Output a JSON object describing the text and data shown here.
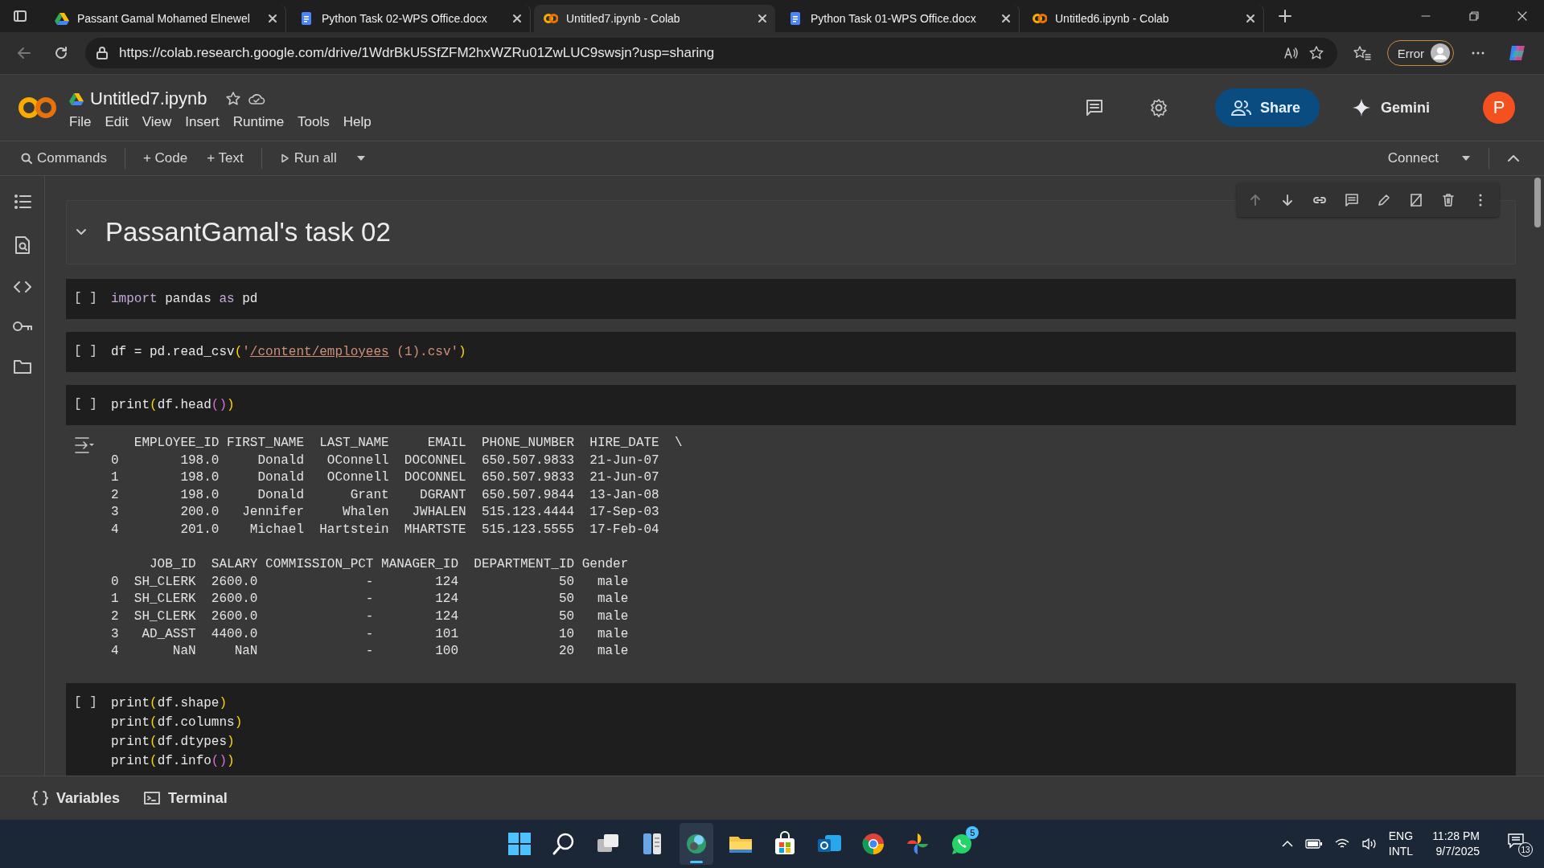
{
  "browser": {
    "tabs": [
      {
        "title": "Passant Gamal Mohamed Elnewel",
        "kind": "drive",
        "selected": false
      },
      {
        "title": "Python Task 02-WPS Office.docx",
        "kind": "document",
        "selected": false
      },
      {
        "title": "Untitled7.ipynb - Colab",
        "kind": "colab",
        "selected": true
      },
      {
        "title": "Python Task 01-WPS Office.docx",
        "kind": "document",
        "selected": false
      },
      {
        "title": "Untitled6.ipynb - Colab",
        "kind": "colab",
        "selected": false
      }
    ],
    "url": "https://colab.research.google.com/drive/1WdrBkU5SfZFM2hxWZRu01ZwLUC9swsjn?usp=sharing",
    "profile_label": "Error"
  },
  "notebook": {
    "title": "Untitled7.ipynb",
    "menu": [
      "File",
      "Edit",
      "View",
      "Insert",
      "Runtime",
      "Tools",
      "Help"
    ],
    "share_label": "Share",
    "gemini_label": "Gemini",
    "avatar_letter": "P"
  },
  "toolbar": {
    "commands": "Commands",
    "add_code": "+ Code",
    "add_text": "+ Text",
    "run_all": "Run all",
    "connect": "Connect"
  },
  "cells": [
    {
      "kind": "heading",
      "text": "PassantGamal's task 02",
      "expanded": true
    },
    {
      "kind": "code",
      "prompt": "[ ]",
      "lines": [
        [
          {
            "t": "import",
            "kind": "keyword"
          },
          {
            "t": " pandas ",
            "kind": "plain"
          },
          {
            "t": "as",
            "kind": "keyword"
          },
          {
            "t": " pd",
            "kind": "plain"
          }
        ]
      ]
    },
    {
      "kind": "code",
      "prompt": "[ ]",
      "lines": [
        [
          {
            "t": "df = pd.read_csv",
            "kind": "plain"
          },
          {
            "t": "(",
            "kind": "paren"
          },
          {
            "t": "'",
            "kind": "string"
          },
          {
            "t": "/content/employees",
            "kind": "link"
          },
          {
            "t": " (1).csv'",
            "kind": "string"
          },
          {
            "t": ")",
            "kind": "paren"
          }
        ]
      ]
    },
    {
      "kind": "code",
      "prompt": "[ ]",
      "lines": [
        [
          {
            "t": "print",
            "kind": "plain"
          },
          {
            "t": "(",
            "kind": "paren"
          },
          {
            "t": "df.head",
            "kind": "plain"
          },
          {
            "t": "()",
            "kind": "paren2"
          },
          {
            "t": ")",
            "kind": "paren"
          }
        ]
      ],
      "output": [
        "   EMPLOYEE_ID FIRST_NAME  LAST_NAME     EMAIL  PHONE_NUMBER  HIRE_DATE  \\",
        "0        198.0     Donald   OConnell  DOCONNEL  650.507.9833  21-Jun-07",
        "1        198.0     Donald   OConnell  DOCONNEL  650.507.9833  21-Jun-07",
        "2        198.0     Donald      Grant    DGRANT  650.507.9844  13-Jan-08",
        "3        200.0   Jennifer     Whalen   JWHALEN  515.123.4444  17-Sep-03",
        "4        201.0    Michael  Hartstein  MHARTSTE  515.123.5555  17-Feb-04"
      ],
      "output_2": [
        "     JOB_ID  SALARY COMMISSION_PCT MANAGER_ID  DEPARTMENT_ID Gender",
        "0  SH_CLERK  2600.0              -        124             50   male",
        "1  SH_CLERK  2600.0              -        124             50   male",
        "2  SH_CLERK  2600.0              -        124             50   male",
        "3   AD_ASST  4400.0              -        101             10   male",
        "4       NaN     NaN              -        100             20   male"
      ]
    },
    {
      "kind": "code",
      "prompt": "[ ]",
      "lines": [
        [
          {
            "t": "print",
            "kind": "plain"
          },
          {
            "t": "(",
            "kind": "paren"
          },
          {
            "t": "df.shape",
            "kind": "plain"
          },
          {
            "t": ")",
            "kind": "paren"
          }
        ],
        [
          {
            "t": "print",
            "kind": "plain"
          },
          {
            "t": "(",
            "kind": "paren"
          },
          {
            "t": "df.columns",
            "kind": "plain"
          },
          {
            "t": ")",
            "kind": "paren"
          }
        ],
        [
          {
            "t": "print",
            "kind": "plain"
          },
          {
            "t": "(",
            "kind": "paren"
          },
          {
            "t": "df.dtypes",
            "kind": "plain"
          },
          {
            "t": ")",
            "kind": "paren"
          }
        ],
        [
          {
            "t": "print",
            "kind": "plain"
          },
          {
            "t": "(",
            "kind": "paren"
          },
          {
            "t": "df.info",
            "kind": "plain"
          },
          {
            "t": "()",
            "kind": "paren2"
          },
          {
            "t": ")",
            "kind": "paren"
          }
        ]
      ]
    }
  ],
  "bottom_bar": {
    "variables": "Variables",
    "terminal": "Terminal"
  },
  "taskbar": {
    "apps": [
      {
        "kind": "start",
        "active": false
      },
      {
        "kind": "search",
        "active": false
      },
      {
        "kind": "taskview",
        "active": false
      },
      {
        "kind": "widgets",
        "active": false
      },
      {
        "kind": "edge",
        "active": true
      },
      {
        "kind": "folder",
        "active": false
      },
      {
        "kind": "store",
        "active": false
      },
      {
        "kind": "mail",
        "active": false
      },
      {
        "kind": "chrome",
        "active": false
      },
      {
        "kind": "pinwheel",
        "active": false
      },
      {
        "kind": "chat",
        "active": false,
        "badge": "5"
      }
    ],
    "language": "ENG",
    "layout": "INTL",
    "time": "11:28 PM",
    "date": "9/7/2025",
    "notifications": "13"
  }
}
